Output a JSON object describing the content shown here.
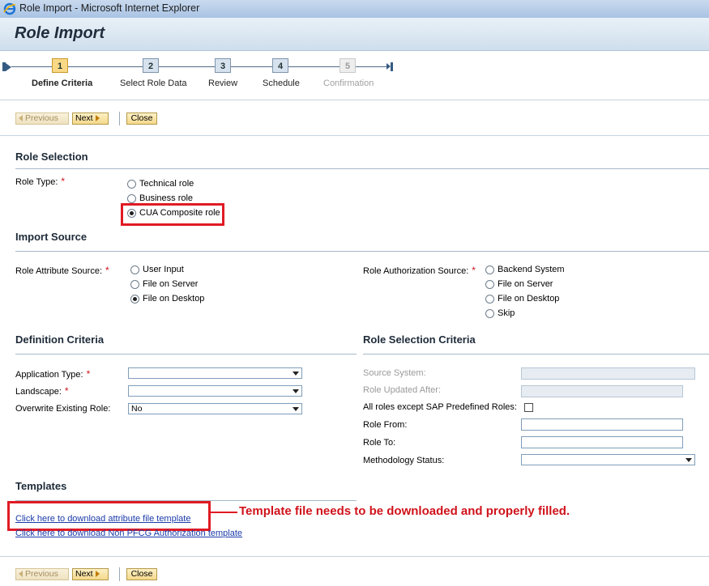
{
  "window": {
    "title": "Role Import - Microsoft Internet Explorer"
  },
  "page": {
    "title": "Role Import"
  },
  "roadmap": {
    "steps": [
      {
        "number": "1",
        "label": "Define Criteria",
        "state": "active"
      },
      {
        "number": "2",
        "label": "Select Role Data",
        "state": "normal"
      },
      {
        "number": "3",
        "label": "Review",
        "state": "normal"
      },
      {
        "number": "4",
        "label": "Schedule",
        "state": "normal"
      },
      {
        "number": "5",
        "label": "Confirmation",
        "state": "disabled"
      }
    ]
  },
  "toolbar": {
    "previous": "Previous",
    "next": "Next",
    "close": "Close"
  },
  "role_selection": {
    "title": "Role Selection",
    "role_type_label": "Role Type:",
    "options": [
      "Technical role",
      "Business role",
      "CUA Composite role"
    ],
    "selected": "CUA Composite role"
  },
  "import_source": {
    "title": "Import Source",
    "attribute_label": "Role Attribute Source:",
    "attribute_options": [
      "User Input",
      "File on Server",
      "File on Desktop"
    ],
    "attribute_selected": "File on Desktop",
    "authorization_label": "Role Authorization Source:",
    "authorization_options": [
      "Backend System",
      "File on Server",
      "File on Desktop",
      "Skip"
    ]
  },
  "definition_criteria": {
    "title": "Definition Criteria",
    "application_type_label": "Application Type:",
    "application_type_value": "",
    "landscape_label": "Landscape:",
    "landscape_value": "",
    "overwrite_label": "Overwrite Existing Role:",
    "overwrite_value": "No"
  },
  "role_selection_criteria": {
    "title": "Role Selection Criteria",
    "source_system_label": "Source System:",
    "role_updated_after_label": "Role Updated After:",
    "all_roles_except_label": "All roles except SAP Predefined Roles:",
    "role_from_label": "Role From:",
    "role_to_label": "Role To:",
    "methodology_status_label": "Methodology Status:"
  },
  "templates": {
    "title": "Templates",
    "attribute_link": "Click here to download attribute file template",
    "authorization_link": "Click here to download Non PFCG Authorization template"
  },
  "annotation": {
    "text": "Template file needs to be downloaded and properly filled."
  },
  "colors": {
    "accent_red": "#e01b24",
    "active_step": "#f9d986",
    "link": "#1a3aa8"
  }
}
